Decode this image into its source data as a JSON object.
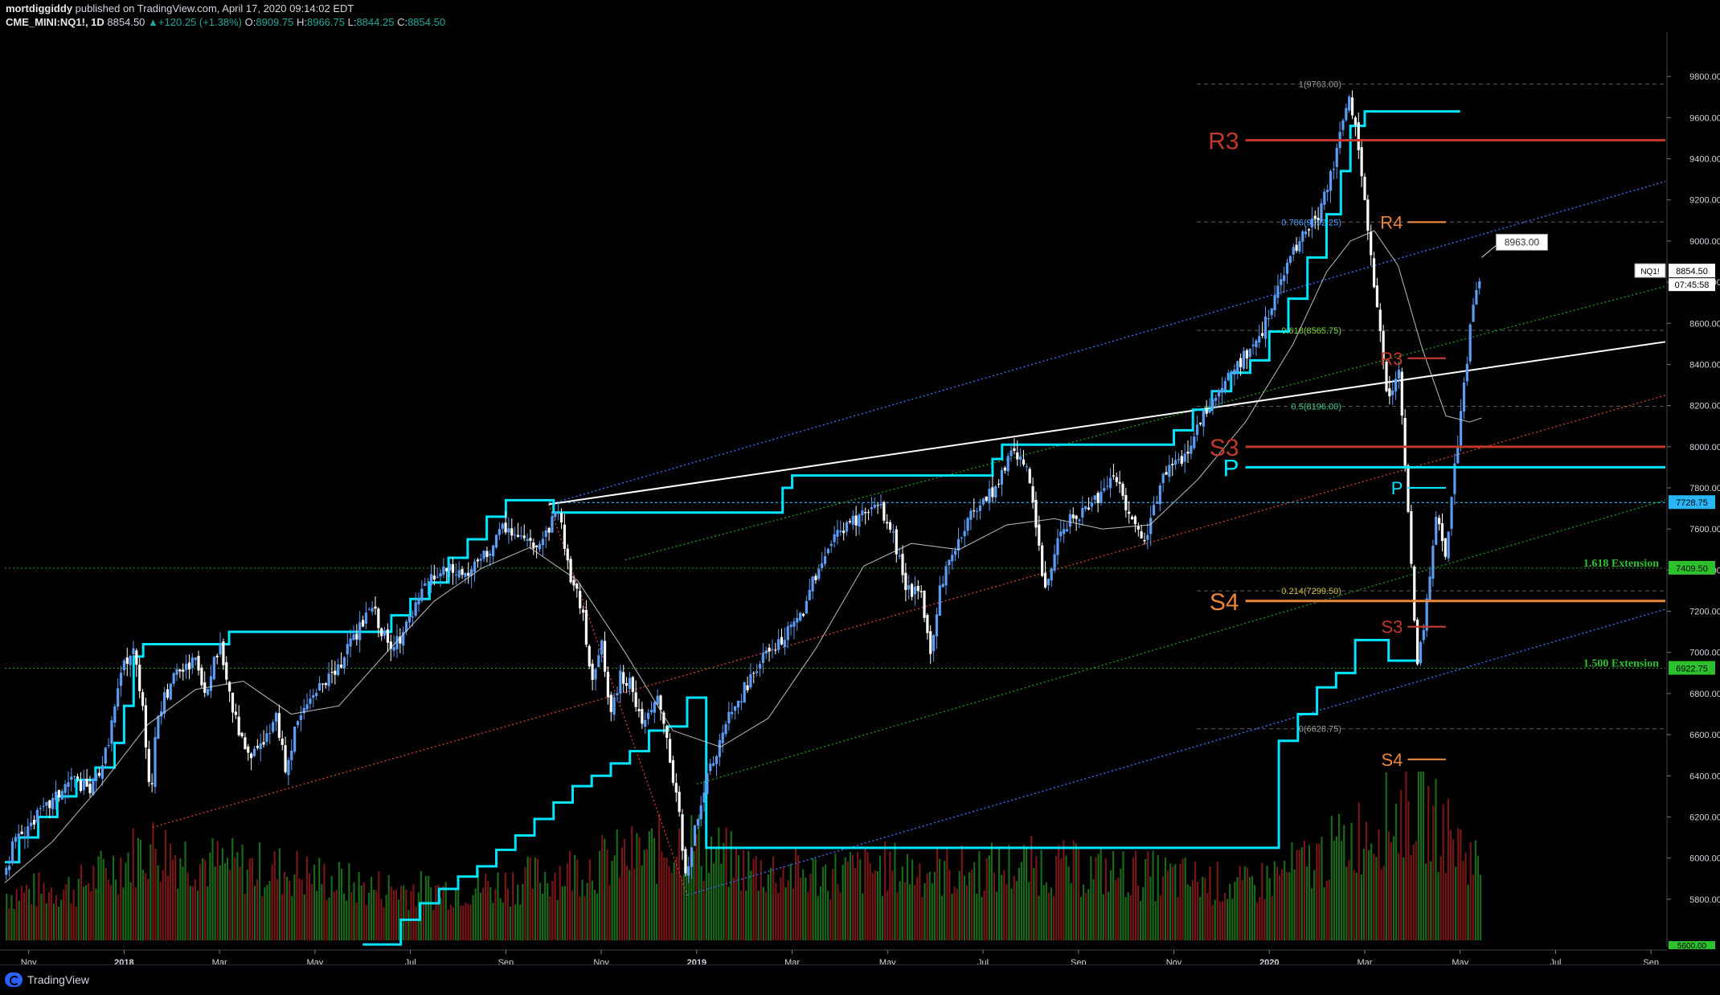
{
  "header": {
    "author": "mortdiggiddy",
    "published": "published on TradingView.com, April 17, 2020 09:14:02 EDT",
    "symbol": "CME_MINI:NQ1!, 1D",
    "last": "8854.50",
    "change": "+120.25 (+1.38%)",
    "o_label": "O:",
    "o": "8909.75",
    "h_label": "H:",
    "h": "8966.75",
    "l_label": "L:",
    "l": "8844.25",
    "c_label": "C:",
    "c": "8854.50"
  },
  "footer": {
    "brand": "TradingView"
  },
  "colors": {
    "background": "#000000",
    "candle_up": "#5b9cf5",
    "candle_down": "#ffffff",
    "stair": "#00e5ff",
    "vol_up": "#1f7a1f",
    "vol_down": "#8b1a1a",
    "fib": "#9e9e9e",
    "pivot_red": "#c0392b",
    "pivot_orange": "#e8873a",
    "trend_white": "#ffffff",
    "channel_blue": "#3d6fff",
    "channel_green": "#1e9e1e",
    "channel_red": "#d9442b",
    "extension_green": "#2ec12e"
  },
  "chart_data": {
    "type": "candlestick",
    "symbol": "CME_MINI:NQ1!",
    "interval": "1D",
    "ylim": [
      5600,
      10000
    ],
    "y_ticks": [
      5800,
      6000,
      6200,
      6400,
      6600,
      6800,
      7000,
      7200,
      7400,
      7600,
      7800,
      8000,
      8200,
      8400,
      8600,
      8800,
      9000,
      9200,
      9400,
      9600,
      9800
    ],
    "y_tick_labels": [
      "5800.00",
      "6000.00",
      "6200.00",
      "6400.00",
      "6600.00",
      "6800.00",
      "7000.00",
      "7200.00",
      "7400.00",
      "7600.00",
      "7800.00",
      "8000.00",
      "8200.00",
      "8400.00",
      "8600.00",
      "8800.00",
      "9000.00",
      "9200.00",
      "9400.00",
      "9600.00",
      "9800.00"
    ],
    "x_ticks": [
      {
        "label": "Nov",
        "t": 0.0
      },
      {
        "label": "2018",
        "t": 2.0
      },
      {
        "label": "Mar",
        "t": 4.0
      },
      {
        "label": "May",
        "t": 6.0
      },
      {
        "label": "Jul",
        "t": 8.0
      },
      {
        "label": "Sep",
        "t": 10.0
      },
      {
        "label": "Nov",
        "t": 12.0
      },
      {
        "label": "2019",
        "t": 14.0
      },
      {
        "label": "Mar",
        "t": 16.0
      },
      {
        "label": "May",
        "t": 18.0
      },
      {
        "label": "Jul",
        "t": 20.0
      },
      {
        "label": "Sep",
        "t": 22.0
      },
      {
        "label": "Nov",
        "t": 24.0
      },
      {
        "label": "2020",
        "t": 26.0
      },
      {
        "label": "Mar",
        "t": 28.0
      },
      {
        "label": "May",
        "t": 30.0
      },
      {
        "label": "Jul",
        "t": 32.0
      },
      {
        "label": "Sep",
        "t": 34.0
      }
    ],
    "x_range": [
      -0.5,
      34.3
    ],
    "price_path": [
      [
        -0.5,
        5920
      ],
      [
        -0.3,
        6080
      ],
      [
        0.0,
        6160
      ],
      [
        0.4,
        6250
      ],
      [
        0.9,
        6390
      ],
      [
        1.3,
        6330
      ],
      [
        1.6,
        6500
      ],
      [
        2.0,
        6950
      ],
      [
        2.2,
        7010
      ],
      [
        2.4,
        6740
      ],
      [
        2.55,
        6280
      ],
      [
        2.7,
        6700
      ],
      [
        3.1,
        6900
      ],
      [
        3.5,
        6950
      ],
      [
        3.7,
        6780
      ],
      [
        4.0,
        7050
      ],
      [
        4.3,
        6690
      ],
      [
        4.6,
        6480
      ],
      [
        4.9,
        6560
      ],
      [
        5.2,
        6680
      ],
      [
        5.4,
        6420
      ],
      [
        5.6,
        6650
      ],
      [
        6.0,
        6820
      ],
      [
        6.4,
        6880
      ],
      [
        6.8,
        7060
      ],
      [
        7.2,
        7220
      ],
      [
        7.6,
        7000
      ],
      [
        8.0,
        7160
      ],
      [
        8.4,
        7360
      ],
      [
        8.8,
        7400
      ],
      [
        9.2,
        7380
      ],
      [
        9.6,
        7480
      ],
      [
        10.0,
        7620
      ],
      [
        10.4,
        7520
      ],
      [
        10.8,
        7560
      ],
      [
        11.1,
        7710
      ],
      [
        11.3,
        7420
      ],
      [
        11.6,
        7200
      ],
      [
        11.8,
        6880
      ],
      [
        12.0,
        7050
      ],
      [
        12.2,
        6680
      ],
      [
        12.4,
        6900
      ],
      [
        12.6,
        6840
      ],
      [
        12.9,
        6640
      ],
      [
        13.2,
        6780
      ],
      [
        13.4,
        6530
      ],
      [
        13.6,
        6260
      ],
      [
        13.8,
        5880
      ],
      [
        14.0,
        6200
      ],
      [
        14.2,
        6370
      ],
      [
        14.6,
        6650
      ],
      [
        15.0,
        6820
      ],
      [
        15.4,
        6980
      ],
      [
        15.8,
        7060
      ],
      [
        16.2,
        7190
      ],
      [
        16.6,
        7440
      ],
      [
        17.0,
        7600
      ],
      [
        17.4,
        7660
      ],
      [
        17.8,
        7720
      ],
      [
        18.1,
        7580
      ],
      [
        18.4,
        7320
      ],
      [
        18.7,
        7270
      ],
      [
        18.9,
        6990
      ],
      [
        19.1,
        7330
      ],
      [
        19.5,
        7560
      ],
      [
        19.9,
        7730
      ],
      [
        20.3,
        7810
      ],
      [
        20.6,
        8000
      ],
      [
        20.9,
        7930
      ],
      [
        21.1,
        7620
      ],
      [
        21.3,
        7280
      ],
      [
        21.6,
        7600
      ],
      [
        22.0,
        7670
      ],
      [
        22.4,
        7740
      ],
      [
        22.8,
        7860
      ],
      [
        23.1,
        7630
      ],
      [
        23.4,
        7540
      ],
      [
        23.8,
        7880
      ],
      [
        24.2,
        7950
      ],
      [
        24.6,
        8150
      ],
      [
        25.0,
        8310
      ],
      [
        25.4,
        8420
      ],
      [
        25.8,
        8520
      ],
      [
        26.2,
        8780
      ],
      [
        26.6,
        8990
      ],
      [
        27.0,
        9120
      ],
      [
        27.2,
        9250
      ],
      [
        27.5,
        9520
      ],
      [
        27.7,
        9700
      ],
      [
        27.9,
        9420
      ],
      [
        28.1,
        8960
      ],
      [
        28.3,
        8580
      ],
      [
        28.5,
        8190
      ],
      [
        28.7,
        8420
      ],
      [
        28.9,
        7720
      ],
      [
        29.1,
        6940
      ],
      [
        29.3,
        7230
      ],
      [
        29.5,
        7650
      ],
      [
        29.7,
        7450
      ],
      [
        29.9,
        7920
      ],
      [
        30.1,
        8340
      ],
      [
        30.3,
        8750
      ],
      [
        30.45,
        8854.5
      ]
    ],
    "ma_path": [
      [
        -0.5,
        5880
      ],
      [
        0.5,
        6080
      ],
      [
        1.5,
        6350
      ],
      [
        2.5,
        6650
      ],
      [
        3.5,
        6820
      ],
      [
        4.5,
        6860
      ],
      [
        5.5,
        6700
      ],
      [
        6.5,
        6740
      ],
      [
        7.5,
        7000
      ],
      [
        8.5,
        7250
      ],
      [
        9.5,
        7410
      ],
      [
        10.5,
        7510
      ],
      [
        11.5,
        7350
      ],
      [
        12.5,
        7000
      ],
      [
        13.5,
        6620
      ],
      [
        14.5,
        6540
      ],
      [
        15.5,
        6680
      ],
      [
        16.5,
        7020
      ],
      [
        17.5,
        7420
      ],
      [
        18.5,
        7530
      ],
      [
        19.5,
        7500
      ],
      [
        20.5,
        7620
      ],
      [
        21.5,
        7650
      ],
      [
        22.5,
        7600
      ],
      [
        23.5,
        7620
      ],
      [
        24.5,
        7840
      ],
      [
        25.5,
        8120
      ],
      [
        26.5,
        8500
      ],
      [
        27.2,
        8850
      ],
      [
        27.7,
        9000
      ],
      [
        28.2,
        9050
      ],
      [
        28.7,
        8880
      ],
      [
        29.2,
        8480
      ],
      [
        29.7,
        8150
      ],
      [
        30.2,
        8120
      ],
      [
        30.45,
        8140
      ]
    ],
    "stair_path": [
      [
        -0.5,
        5980
      ],
      [
        -0.2,
        6100
      ],
      [
        0.2,
        6200
      ],
      [
        0.6,
        6300
      ],
      [
        1.0,
        6380
      ],
      [
        1.4,
        6440
      ],
      [
        1.8,
        6560
      ],
      [
        2.0,
        6740
      ],
      [
        2.2,
        6980
      ],
      [
        2.4,
        7040
      ],
      [
        3.4,
        7040
      ],
      [
        4.2,
        7100
      ],
      [
        7.4,
        7100
      ],
      [
        7.6,
        7180
      ],
      [
        8.0,
        7260
      ],
      [
        8.4,
        7340
      ],
      [
        8.8,
        7460
      ],
      [
        9.2,
        7550
      ],
      [
        9.6,
        7660
      ],
      [
        10.0,
        7740
      ],
      [
        10.6,
        7740
      ],
      [
        11.0,
        7680
      ],
      [
        15.4,
        7680
      ],
      [
        15.8,
        7800
      ],
      [
        16.0,
        7860
      ],
      [
        18.2,
        7860
      ],
      [
        18.4,
        7860
      ],
      [
        19.8,
        7860
      ],
      [
        20.2,
        7940
      ],
      [
        20.4,
        8010
      ],
      [
        21.8,
        8010
      ],
      [
        23.6,
        8010
      ],
      [
        24.0,
        8080
      ],
      [
        24.4,
        8180
      ],
      [
        24.8,
        8270
      ],
      [
        25.2,
        8360
      ],
      [
        25.6,
        8420
      ],
      [
        26.0,
        8560
      ],
      [
        26.4,
        8720
      ],
      [
        26.8,
        8920
      ],
      [
        27.2,
        9130
      ],
      [
        27.5,
        9340
      ],
      [
        27.7,
        9560
      ],
      [
        28.0,
        9630
      ],
      [
        29.0,
        9630
      ],
      [
        29.2,
        9630
      ],
      [
        30.0,
        9630
      ]
    ],
    "stair_lower_path": [
      [
        7.0,
        5580
      ],
      [
        7.4,
        5580
      ],
      [
        7.8,
        5700
      ],
      [
        8.2,
        5780
      ],
      [
        8.6,
        5850
      ],
      [
        9.0,
        5910
      ],
      [
        9.4,
        5960
      ],
      [
        9.8,
        6040
      ],
      [
        10.2,
        6110
      ],
      [
        10.6,
        6190
      ],
      [
        11.0,
        6270
      ],
      [
        11.4,
        6350
      ],
      [
        11.8,
        6400
      ],
      [
        12.2,
        6460
      ],
      [
        12.6,
        6520
      ],
      [
        13.0,
        6620
      ],
      [
        13.4,
        6640
      ],
      [
        13.8,
        6780
      ],
      [
        14.0,
        6780
      ],
      [
        14.2,
        6050
      ],
      [
        26.0,
        6050
      ],
      [
        26.2,
        6570
      ],
      [
        26.6,
        6700
      ],
      [
        27.0,
        6830
      ],
      [
        27.4,
        6900
      ],
      [
        27.8,
        7060
      ],
      [
        28.2,
        7060
      ],
      [
        28.5,
        6960
      ],
      [
        29.2,
        6960
      ]
    ],
    "fib_levels": [
      {
        "label": "1(9763.00)",
        "value": 9763.0
      },
      {
        "label": "0.786(9092.25)",
        "value": 9092.25
      },
      {
        "label": "0.618(8565.75)",
        "value": 8565.75
      },
      {
        "label": "0.5(8196.00)",
        "value": 8196.0
      },
      {
        "label": "0.214(7299.50)",
        "value": 7299.5
      },
      {
        "label": "0(6628.75)",
        "value": 6628.75
      }
    ],
    "pivots": [
      {
        "label": "R3",
        "value": 9490,
        "t_start": 25.5,
        "t_end": 34.3,
        "color": "red",
        "size": "large"
      },
      {
        "label": "R4",
        "value": 9092,
        "t_start": 28.9,
        "t_end": 29.7,
        "color": "orange",
        "size": "small"
      },
      {
        "label": "R3",
        "value": 8430,
        "t_start": 28.9,
        "t_end": 29.7,
        "color": "red",
        "size": "small"
      },
      {
        "label": "S3",
        "value": 8000,
        "t_start": 25.5,
        "t_end": 34.3,
        "color": "red",
        "size": "large"
      },
      {
        "label": "P",
        "value": 7900,
        "t_start": 25.5,
        "t_end": 34.3,
        "color": "cyan",
        "size": "large"
      },
      {
        "label": "P",
        "value": 7800,
        "t_start": 28.9,
        "t_end": 29.7,
        "color": "cyan",
        "size": "small"
      },
      {
        "label": "S4",
        "value": 7250,
        "t_start": 25.5,
        "t_end": 34.3,
        "color": "orange",
        "size": "large"
      },
      {
        "label": "S3",
        "value": 7125,
        "t_start": 28.9,
        "t_end": 29.7,
        "color": "red",
        "size": "small"
      },
      {
        "label": "S4",
        "value": 6480,
        "t_start": 28.9,
        "t_end": 29.7,
        "color": "orange",
        "size": "small"
      }
    ],
    "extensions": [
      {
        "label": "1.618 Extension",
        "value": 7409.5,
        "tag": "7409.50"
      },
      {
        "label": "1.500 Extension",
        "value": 6922.75,
        "tag": "6922.75"
      }
    ],
    "horizontal_tags": [
      {
        "value": 7728.75,
        "tag": "7728.75"
      }
    ],
    "trend_line": {
      "from": [
        10.9,
        7720
      ],
      "to": [
        34.3,
        8510
      ]
    },
    "channel_upper": {
      "from": [
        10.9,
        7720
      ],
      "to": [
        34.3,
        9290
      ]
    },
    "channel_lower": {
      "from": [
        13.8,
        5820
      ],
      "to": [
        34.3,
        7210
      ]
    },
    "channel_red": {
      "from": [
        2.6,
        6150
      ],
      "to": [
        34.3,
        8250
      ]
    },
    "channel_green_1": {
      "from": [
        12.5,
        7450
      ],
      "to": [
        34.3,
        8780
      ]
    },
    "channel_green_2": {
      "from": [
        14.0,
        6360
      ],
      "to": [
        34.3,
        7740
      ]
    },
    "drop_line": {
      "from": [
        10.9,
        7720
      ],
      "to": [
        13.8,
        5820
      ]
    },
    "callout": {
      "label": "8963.00",
      "value": 8963,
      "t": 30.45
    },
    "last_price_tag": {
      "symbol": "NQ1!",
      "price": "8854.50",
      "countdown": "07:45:58",
      "value": 8854.5
    },
    "volume": {
      "max": 100,
      "note": "relative daily volume, tallest near Mar 2020",
      "profile": [
        [
          -0.5,
          30
        ],
        [
          1.0,
          34
        ],
        [
          2.5,
          60
        ],
        [
          4.0,
          48
        ],
        [
          5.5,
          44
        ],
        [
          7.0,
          34
        ],
        [
          8.5,
          32
        ],
        [
          10.0,
          36
        ],
        [
          11.5,
          46
        ],
        [
          13.0,
          56
        ],
        [
          13.8,
          64
        ],
        [
          15.0,
          46
        ],
        [
          16.5,
          42
        ],
        [
          18.0,
          46
        ],
        [
          19.5,
          44
        ],
        [
          21.0,
          48
        ],
        [
          22.5,
          44
        ],
        [
          24.0,
          40
        ],
        [
          25.5,
          34
        ],
        [
          27.0,
          52
        ],
        [
          28.2,
          74
        ],
        [
          29.0,
          86
        ],
        [
          29.6,
          72
        ],
        [
          30.45,
          46
        ]
      ]
    },
    "y_bottom_tag": "5600.00"
  }
}
